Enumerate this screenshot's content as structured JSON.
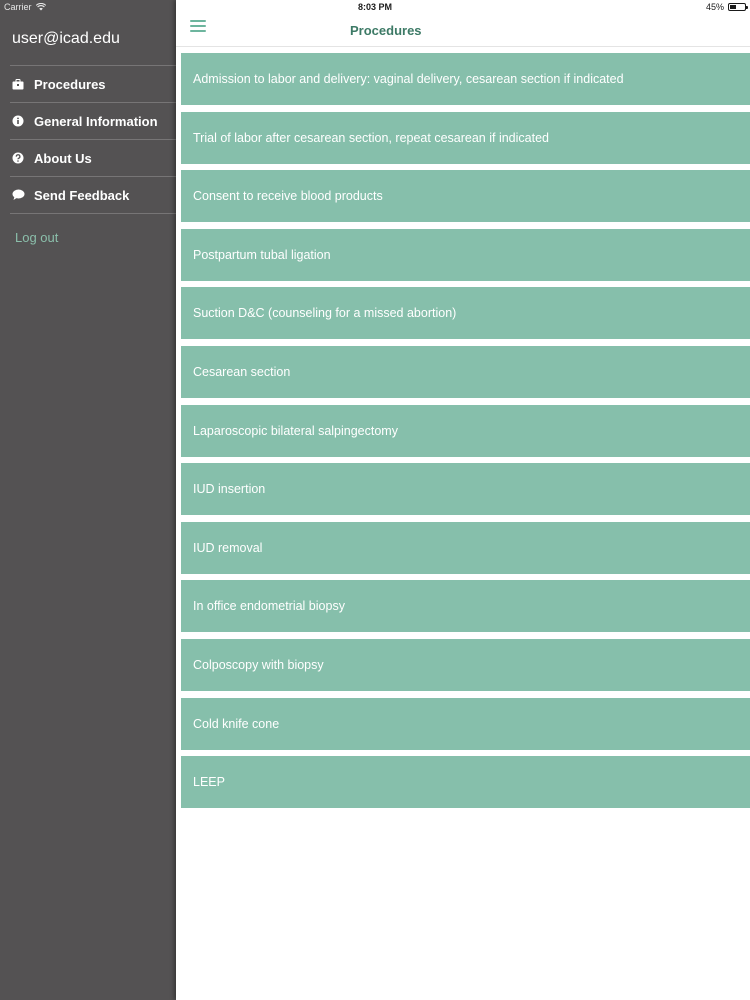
{
  "status_bar": {
    "carrier": "Carrier",
    "time": "8:03 PM",
    "battery": "45%",
    "battery_level": 0.45
  },
  "sidebar": {
    "email": "user@icad.edu",
    "items": [
      {
        "label": "Procedures",
        "icon": "briefcase-icon"
      },
      {
        "label": "General Information",
        "icon": "info-icon"
      },
      {
        "label": "About Us",
        "icon": "question-icon"
      },
      {
        "label": "Send Feedback",
        "icon": "chat-bubble-icon"
      }
    ],
    "logout_label": "Log out"
  },
  "header": {
    "title": "Procedures"
  },
  "procedures": [
    "Admission to labor and delivery: vaginal delivery, cesarean section if indicated",
    "Trial of labor after cesarean section, repeat cesarean if indicated",
    "Consent to receive blood products",
    "Postpartum tubal ligation",
    "Suction D&C (counseling for a missed abortion)",
    "Cesarean section",
    "Laparoscopic bilateral salpingectomy",
    "IUD insertion",
    "IUD removal",
    "In office endometrial biopsy",
    "Colposcopy with biopsy",
    "Cold knife cone",
    "LEEP"
  ],
  "colors": {
    "sidebar_bg": "#545253",
    "accent": "#6db59e",
    "list_item_bg": "#86bfab",
    "title_color": "#3d7a66",
    "logout_color": "#8bbfab"
  }
}
